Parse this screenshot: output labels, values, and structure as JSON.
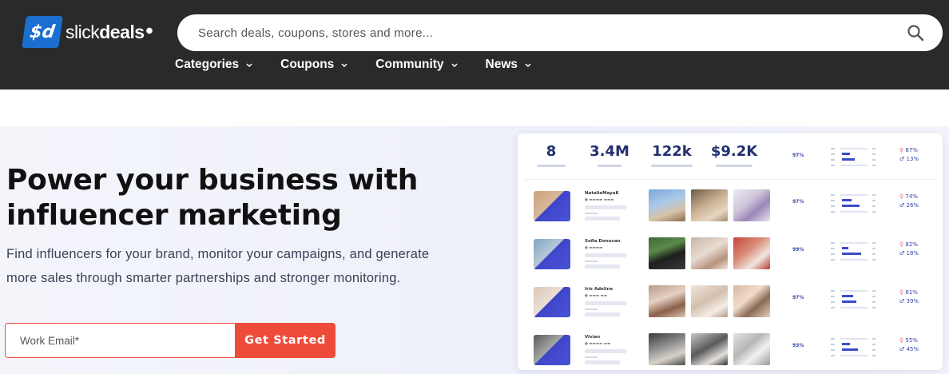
{
  "header": {
    "logo_mark": "$d",
    "logo_prefix": "slick",
    "logo_bold": "deals",
    "search_placeholder": "Search deals, coupons, stores and more...",
    "nav": [
      "Categories",
      "Coupons",
      "Community",
      "News"
    ]
  },
  "hero": {
    "title": "Power your business with influencer marketing",
    "subtitle": "Find influencers for your brand, monitor your campaigns, and generate more sales through smarter partnerships and stronger monitoring.",
    "email_placeholder": "Work Email*",
    "cta_label": "Get Started"
  },
  "dashboard": {
    "stats": [
      "8",
      "3.4M",
      "122k",
      "$9.2K"
    ],
    "header_pct": "97%",
    "header_female": "87%",
    "header_male": "13%",
    "rows": [
      {
        "name": "NatalieMayaK",
        "pct": "97%",
        "female": "74%",
        "male": "26%"
      },
      {
        "name": "Sofia Donovan",
        "pct": "99%",
        "female": "82%",
        "male": "18%"
      },
      {
        "name": "Iris Adeline",
        "pct": "97%",
        "female": "61%",
        "male": "39%"
      },
      {
        "name": "Vivian",
        "pct": "93%",
        "female": "55%",
        "male": "45%"
      }
    ]
  },
  "colors": {
    "header_bg": "#2a2a2c",
    "brand_blue": "#1a6fd0",
    "cta_red": "#ef4b3a",
    "stat_navy": "#23306f"
  },
  "icons": {
    "search": "search-icon",
    "chevron": "chevron-down-icon"
  }
}
